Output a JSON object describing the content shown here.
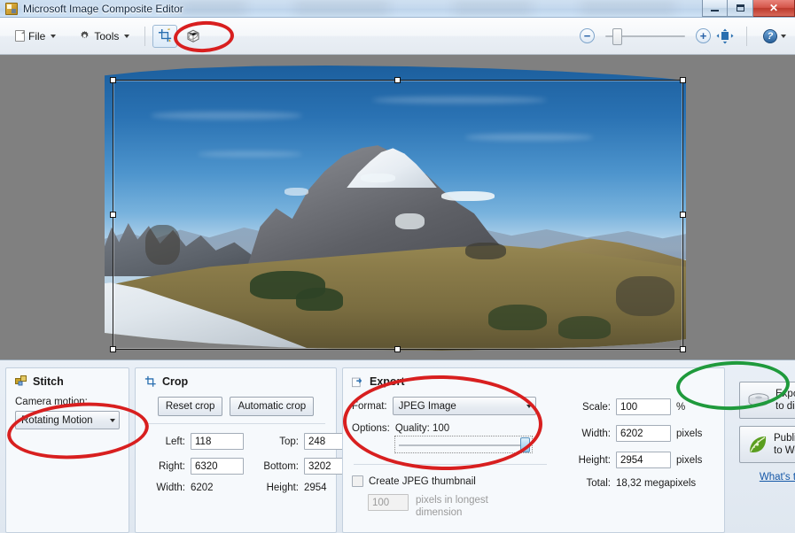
{
  "window": {
    "title": "Microsoft Image Composite Editor",
    "app_icon": "mice-app-icon",
    "controls": {
      "minimize": "Minimize",
      "maximize": "Restore Down",
      "close": "Close",
      "close_glyph": "✕"
    }
  },
  "toolbar": {
    "menus": [
      {
        "label": "File",
        "accel": "F",
        "icon": "document-icon"
      },
      {
        "label": "Tools",
        "accel": "T",
        "icon": "gear-icon"
      }
    ],
    "tools": [
      {
        "name": "crop-tool",
        "label": "Crop",
        "icon": "crop-icon",
        "active": true
      },
      {
        "name": "orientation-tool",
        "label": "Adjust orientation",
        "icon": "cube-3d-icon",
        "active": false
      }
    ],
    "zoom": {
      "out_label": "−",
      "in_label": "+",
      "value": 8,
      "fit_label": "Fit to window",
      "fit_icon": "fit-to-window-icon"
    },
    "help": {
      "label": "?",
      "icon": "help-icon",
      "caret": "▾"
    }
  },
  "canvas": {
    "background_color": "#808080",
    "image_alt": "Stitched mountain panorama with snow-capped peak",
    "crop_selection": {
      "visible": true,
      "handle_count": 8,
      "handle_color": "#ffffff"
    }
  },
  "panels": {
    "stitch": {
      "title": "Stitch",
      "icon": "stitch-icon",
      "camera_motion_label": "Camera motion:",
      "camera_motion_value": "Rotating Motion",
      "camera_motion_caret": "▾"
    },
    "crop": {
      "title": "Crop",
      "icon": "crop-icon",
      "reset_label": "Reset crop",
      "automatic_label": "Automatic crop",
      "fields": [
        {
          "label": "Left:",
          "value": "118"
        },
        {
          "label": "Top:",
          "value": "248"
        },
        {
          "label": "Right:",
          "value": "6320"
        },
        {
          "label": "Bottom:",
          "value": "3202"
        }
      ],
      "readonly": [
        {
          "label": "Width:",
          "value": "6202"
        },
        {
          "label": "Height:",
          "value": "2954"
        }
      ]
    },
    "export": {
      "title": "Export",
      "icon": "export-icon",
      "format_label": "Format:",
      "format_value": "JPEG Image",
      "format_caret": "▾",
      "options_label": "Options:",
      "quality_label": "Quality: 100",
      "quality_value": 100,
      "thumbnail_label": "Create JPEG thumbnail",
      "thumbnail_checked": false,
      "thumbnail_size": "100",
      "thumbnail_hint_1": "pixels in longest",
      "thumbnail_hint_2": "dimension",
      "output": [
        {
          "label": "Scale:",
          "value": "100",
          "unit": "%"
        },
        {
          "label": "Width:",
          "value": "6202",
          "unit": "pixels"
        },
        {
          "label": "Height:",
          "value": "2954",
          "unit": "pixels"
        }
      ],
      "total_label": "Total:",
      "total_value": "18,32 megapixels"
    },
    "actions": {
      "export_disk_line1": "Export",
      "export_disk_line2": "to disk...",
      "export_disk_icon": "disk-drive-icon",
      "publish_web_line1": "Publish",
      "publish_web_line2": "to Web...",
      "publish_web_icon": "leaf-icon",
      "whats_this": "What's this?"
    }
  },
  "annotations": [
    {
      "name": "annotation-toolbar-cube",
      "color": "#d81f1f",
      "shape": "ellipse"
    },
    {
      "name": "annotation-camera-motion",
      "color": "#d81f1f",
      "shape": "ellipse"
    },
    {
      "name": "annotation-export-format",
      "color": "#d81f1f",
      "shape": "ellipse"
    },
    {
      "name": "annotation-export-to-disk",
      "color": "#1f9a3c",
      "shape": "ellipse"
    }
  ]
}
